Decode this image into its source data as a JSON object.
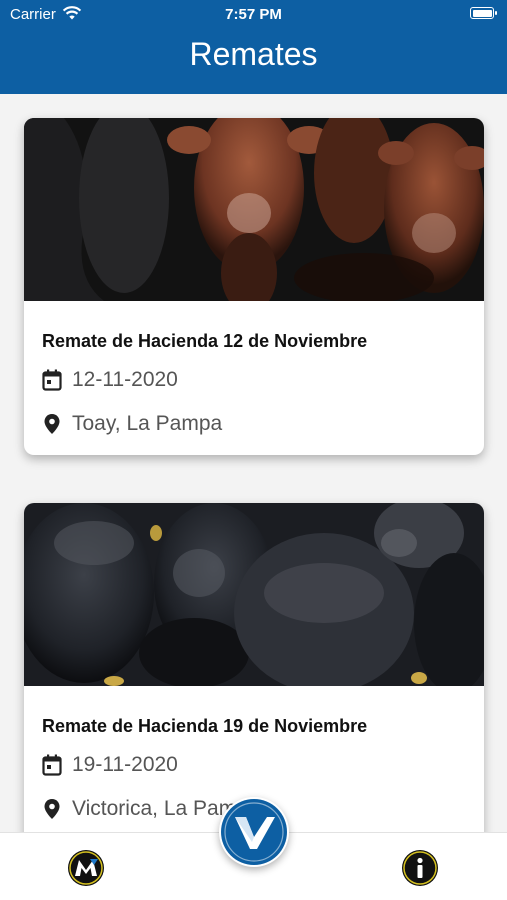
{
  "status_bar": {
    "carrier": "Carrier",
    "time": "7:57 PM",
    "icons": [
      "wifi-icon",
      "battery-icon"
    ]
  },
  "header": {
    "title": "Remates",
    "background_color": "#0d5fa3"
  },
  "cards": [
    {
      "image": "red cattle herd photo",
      "title": "Remate de Hacienda 12 de Noviembre",
      "date": "12-11-2020",
      "location": "Toay, La Pampa"
    },
    {
      "image": "black cattle herd photo",
      "title": "Remate de Hacienda 19 de Noviembre",
      "date": "19-11-2020",
      "location": "Victorica, La Pampa"
    }
  ],
  "tab_bar": {
    "left_icon": "m-logo-icon",
    "center_icon": "v-logo-icon",
    "right_icon": "info-icon",
    "accent_color": "#0d5fa3"
  }
}
